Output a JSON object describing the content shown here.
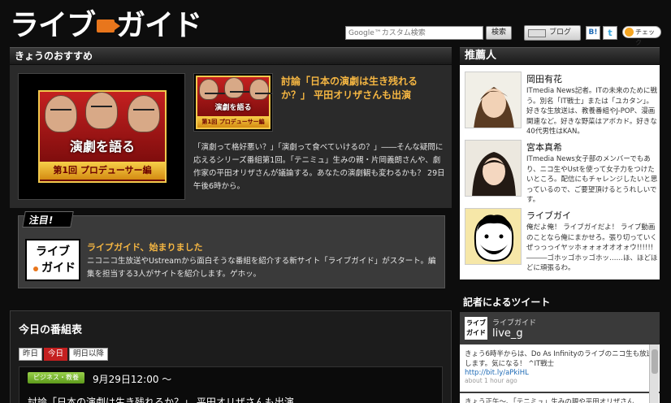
{
  "header": {
    "logo_text_1": "ライブ",
    "logo_text_2": "ガイド",
    "search_placeholder": "Google™カスタム検索",
    "search_button": "検索",
    "blog_button": "ブログ",
    "hatena_label": "B!",
    "twitter_label": "t",
    "check_button": "チェック"
  },
  "sections": {
    "recommend": "きょうのおすすめ",
    "recommenders": "推薦人",
    "tweets": "記者によるツイート",
    "schedule": "今日の番組表"
  },
  "featured": {
    "banner_title": "演劇を語る",
    "banner_subtitle": "第1回 プロデューサー編",
    "thumb_title": "演劇を語る",
    "thumb_subtitle": "第1回 プロデューサー編",
    "headline": "討論「日本の演劇は生き残れるか？」 平田オリザさんも出演",
    "description": "「演劇って格好悪い？」「演劇って食べていけるの？」――そんな疑問に応えるシリーズ番組第1回。「テニミュ」生みの親・片岡義朗さんや、劇作家の平田オリザさんが議論する。あなたの演劇観も変わるかも？ 29日午後6時から。"
  },
  "notice": {
    "badge": "注目!",
    "logo_line1": "ライブ",
    "logo_line2": "ガイド",
    "title": "ライブガイド、始まりました",
    "description": "ニコニコ生放送やUstreamから面白そうな番組を紹介する新サイト「ライブガイド」がスタート。編集を担当する3人がサイトを紹介します。ゲホッ。"
  },
  "schedule": {
    "tabs": [
      {
        "label": "昨日",
        "active": false
      },
      {
        "label": "今日",
        "active": true
      },
      {
        "label": "明日以降",
        "active": false
      }
    ],
    "program_tag": "ビジネス・教養",
    "program_time": "9月29日12:00 〜",
    "program_title": "討論「日本の演劇は生き残れるか？」 平田オリザさんも出演"
  },
  "recommenders": [
    {
      "name": "岡田有花",
      "desc": "ITmedia News記者。ITの未来のために戦う。別名「IT戦士」または「ユカタン」。好きな生放送は、教養番組やJ-POP、漫画関連など。好きな野菜はアボカド。好きな40代男性はKAN。"
    },
    {
      "name": "宮本真希",
      "desc": "ITmedia News女子部のメンバーでもあり、ニコ生やUstを使って女子力をつけたいところ。配信にもチャレンジしたいと思っているので、ご要望頂けるとうれしいです。"
    },
    {
      "name": "ライブガイ",
      "desc": "俺だよ俺！ ライブガイだよ！ ライブ動画のことなら俺にまかせろ。張り切っていくぜっっっイヤッホォォォオオオォウ!!!!!!―――ゴホッゴホッゴホッ……ほ、ほどほどに頑張るわ。"
    }
  ],
  "tweet": {
    "avatar_line1": "ライブ",
    "avatar_line2": "ガイド",
    "account_name": "ライブガイド",
    "handle": "live_g",
    "text": "きょう6時半からは、Do As Infinityのライブのニコ生も放送します。気になる！ ^IT戦士",
    "link": "http://bit.ly/aPkiHL",
    "time": "about 1 hour ago",
    "next_text": "きょう正午〜、「テニミュ」生みの親や平田オリザさん"
  },
  "colors": {
    "accent_orange": "#f5b642",
    "brand_red": "#c42020",
    "tag_green": "#5d9a1b"
  }
}
